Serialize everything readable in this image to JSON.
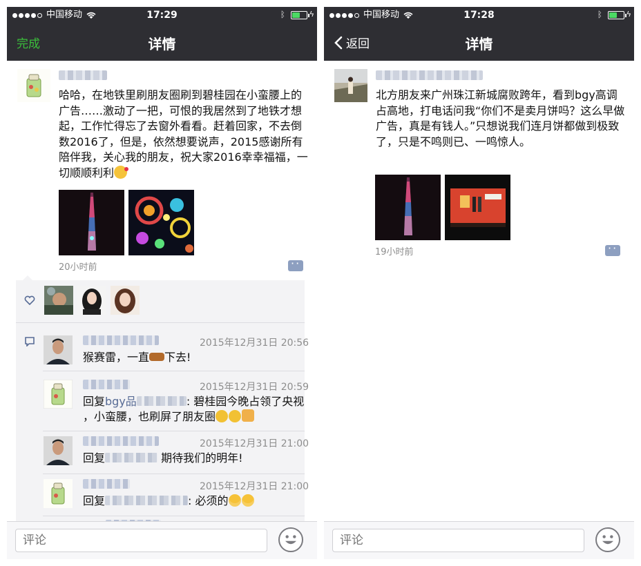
{
  "status": {
    "carrier": "中国移动",
    "time_left": "17:29",
    "time_right": "17:28"
  },
  "left": {
    "nav_left_label": "完成",
    "nav_title": "详情",
    "post": {
      "text": "哈哈，在地铁里刷朋友圈刷到碧桂园在小蛮腰上的广告……激动了一把，可恨的我居然到了地铁才想起，工作忙得忘了去窗外看看。赶着回家，不去倒数2016了，但是，依然想要说声，2015感谢所有陪伴我，关心我的朋友，祝大家2016幸幸福福，一切顺顺利利",
      "time": "20小时前"
    },
    "comments": [
      {
        "time": "2015年12月31日 20:56",
        "text_pre": "猴赛雷，一直",
        "text_post": "下去!"
      },
      {
        "time": "2015年12月31日 20:59",
        "reply": "回复",
        "reply_to": "bgy品",
        "line1": ": 碧桂园今晚占领了央视",
        "line2": "，小蛮腰，也刷屏了朋友圈"
      },
      {
        "time": "2015年12月31日 21:00",
        "reply": "回复",
        "reply_to": "",
        "line1": " 期待我们的明年!"
      },
      {
        "time": "2015年12月31日 21:00",
        "reply": "回复",
        "reply_to": "",
        "line1": ": 必须的"
      }
    ],
    "comment_placeholder": "评论"
  },
  "right": {
    "nav_back_label": "返回",
    "nav_title": "详情",
    "post": {
      "text": "北方朋友来广州珠江新城腐败跨年，看到bgy高调占高地，打电话问我“你们不是卖月饼吗？这么早做广告，真是有钱人。”只想说我们连月饼都做到极致了，只是不鸣则已、一鸣惊人。",
      "time": "19小时前"
    },
    "comment_placeholder": "评论"
  },
  "colors": {
    "navbar": "#2e2e33",
    "done_green": "#3bbf3b",
    "link_blue": "#576b95",
    "battery_green": "#4cd964"
  },
  "icons": [
    "signal-dots-icon",
    "wifi-icon",
    "bluetooth-icon",
    "battery-icon",
    "charging-icon",
    "back-chevron-icon",
    "heart-icon",
    "comment-bubble-icon",
    "comment-action-icon",
    "emoji-smiley-icon"
  ]
}
